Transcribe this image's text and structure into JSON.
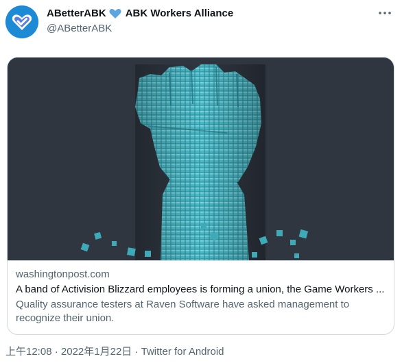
{
  "author": {
    "display_name": "ABetterABK",
    "org_name": "ABK Workers Alliance",
    "handle": "@ABetterABK",
    "avatar_icon": "heart-check-logo",
    "name_emoji": "blue-heart-icon"
  },
  "card": {
    "image_alt": "voxel-raised-fist",
    "domain": "washingtonpost.com",
    "title": "A band of Activision Blizzard employees is forming a union, the Game Workers ...",
    "description": "Quality assurance testers at Raven Software have asked management to recognize their union."
  },
  "meta": {
    "time": "上午12:08",
    "separator": " · ",
    "date": "2022年1月22日",
    "source": "Twitter for Android"
  },
  "colors": {
    "accent": "#1f7fd0",
    "heart": "#5ba6e0",
    "fist": "#3fa9b8",
    "card_bg": "#2f3640"
  }
}
